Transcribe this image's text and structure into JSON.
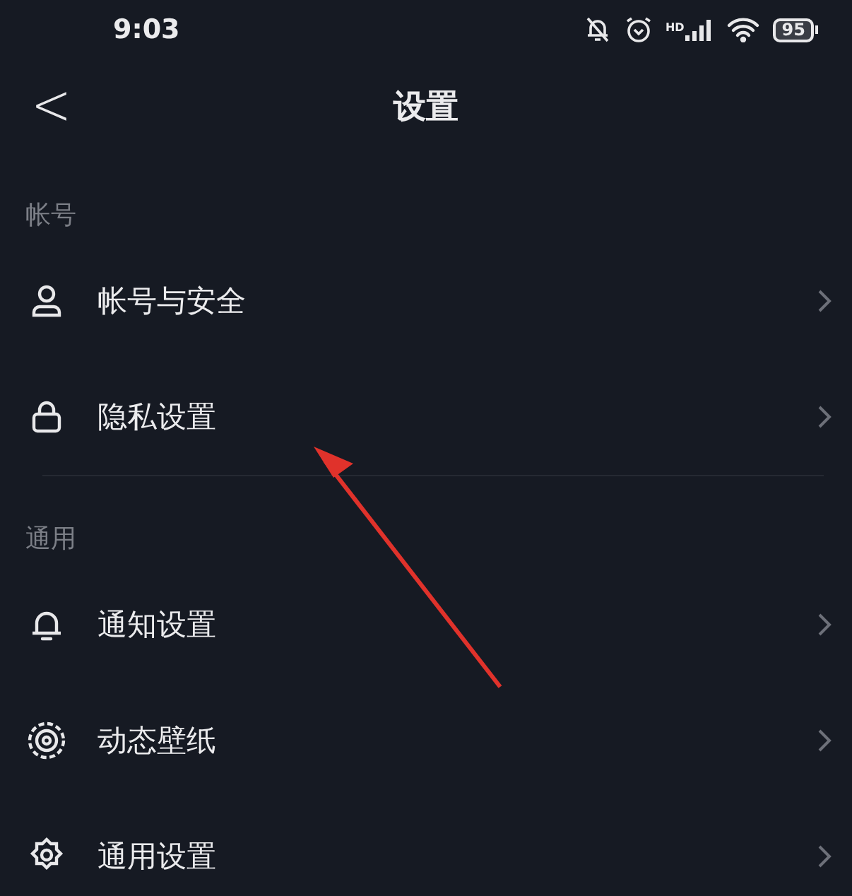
{
  "status_bar": {
    "time": "9:03",
    "network": "HD",
    "battery": "95"
  },
  "header": {
    "back": "<",
    "title": "设置"
  },
  "sections": [
    {
      "title": "帐号",
      "items": [
        {
          "kind": "user",
          "label": "帐号与安全"
        },
        {
          "kind": "lock",
          "label": "隐私设置"
        }
      ]
    },
    {
      "title": "通用",
      "items": [
        {
          "kind": "bell",
          "label": "通知设置"
        },
        {
          "kind": "wallpaper",
          "label": "动态壁纸"
        },
        {
          "kind": "gear",
          "label": "通用设置"
        }
      ]
    }
  ]
}
